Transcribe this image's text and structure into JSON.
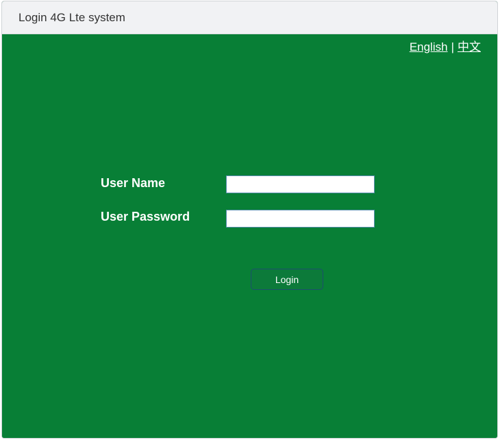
{
  "window": {
    "title": "Login 4G Lte system"
  },
  "language": {
    "english": "English",
    "separator": "|",
    "chinese": "中文"
  },
  "form": {
    "username_label": "User Name",
    "username_value": "",
    "password_label": "User Password",
    "password_value": "",
    "login_label": "Login"
  },
  "colors": {
    "background": "#087f36",
    "titlebar": "#f1f2f4",
    "text": "#ffffff"
  }
}
